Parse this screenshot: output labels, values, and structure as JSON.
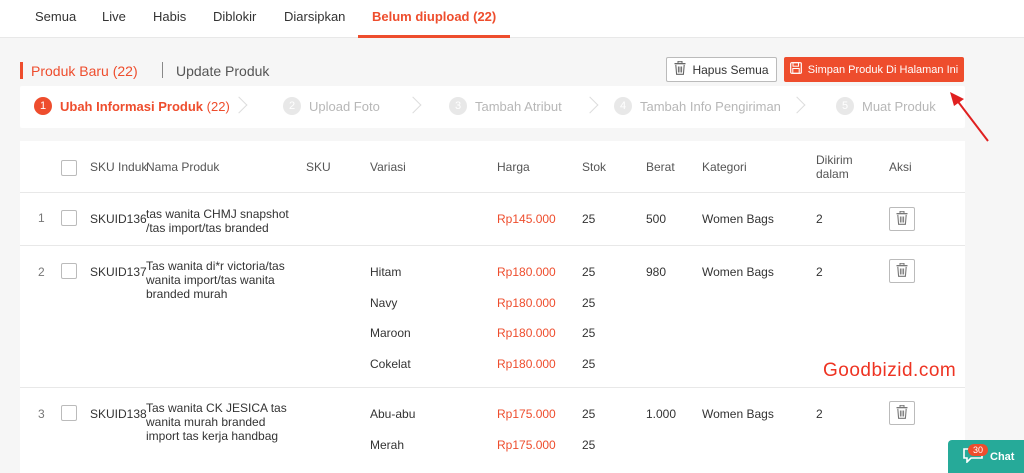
{
  "tabs": [
    "Semua",
    "Live",
    "Habis",
    "Diblokir",
    "Diarsipkan",
    "Belum diupload (22)"
  ],
  "header": {
    "title_new": "Produk Baru (22)",
    "title_update": "Update Produk",
    "btn_delete_all": "Hapus Semua",
    "btn_save_page": "Simpan Produk Di Halaman Ini"
  },
  "steps": [
    {
      "num": "1",
      "label": "Ubah Informasi Produk",
      "count": "(22)"
    },
    {
      "num": "2",
      "label": "Upload Foto"
    },
    {
      "num": "3",
      "label": "Tambah Atribut"
    },
    {
      "num": "4",
      "label": "Tambah Info Pengiriman"
    },
    {
      "num": "5",
      "label": "Muat Produk"
    }
  ],
  "columns": {
    "sku_induk": "SKU Induk",
    "nama": "Nama Produk",
    "sku": "SKU",
    "variasi": "Variasi",
    "harga": "Harga",
    "stok": "Stok",
    "berat": "Berat",
    "kategori": "Kategori",
    "dikirim": "Dikirim dalam",
    "aksi": "Aksi"
  },
  "products": [
    {
      "idx": "1",
      "sku": "SKUID136",
      "name": "tas wanita CHMJ snapshot /tas import/tas branded",
      "berat": "500",
      "kategori": "Women Bags",
      "dikirim": "2",
      "variants": [
        {
          "variasi": "",
          "harga": "Rp145.000",
          "stok": "25"
        }
      ]
    },
    {
      "idx": "2",
      "sku": "SKUID137",
      "name": "Tas wanita di*r victoria/tas wanita import/tas wanita branded murah",
      "berat": "980",
      "kategori": "Women Bags",
      "dikirim": "2",
      "variants": [
        {
          "variasi": "Hitam",
          "harga": "Rp180.000",
          "stok": "25"
        },
        {
          "variasi": "Navy",
          "harga": "Rp180.000",
          "stok": "25"
        },
        {
          "variasi": "Maroon",
          "harga": "Rp180.000",
          "stok": "25"
        },
        {
          "variasi": "Cokelat",
          "harga": "Rp180.000",
          "stok": "25"
        }
      ]
    },
    {
      "idx": "3",
      "sku": "SKUID138",
      "name": "Tas wanita CK JESICA tas wanita murah branded import tas kerja handbag",
      "berat": "1.000",
      "kategori": "Women Bags",
      "dikirim": "2",
      "variants": [
        {
          "variasi": "Abu-abu",
          "harga": "Rp175.000",
          "stok": "25"
        },
        {
          "variasi": "Merah",
          "harga": "Rp175.000",
          "stok": "25"
        }
      ]
    }
  ],
  "watermark": "Goodbizid.com",
  "chat": {
    "badge": "30",
    "label": "Chat"
  },
  "colors": {
    "accent": "#ee4d2d",
    "chat": "#26aa99"
  }
}
